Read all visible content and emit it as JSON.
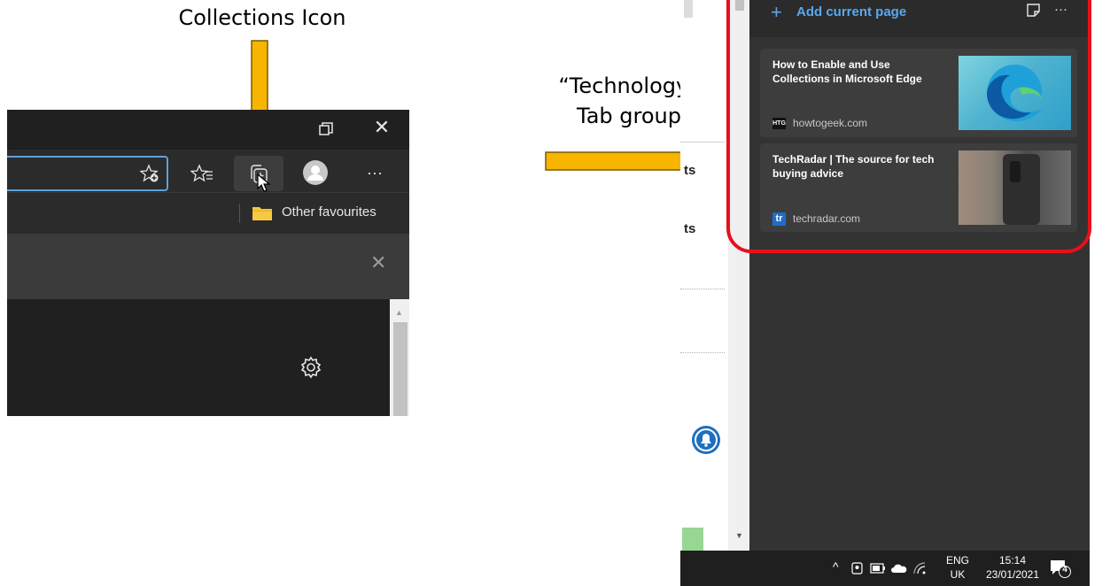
{
  "annotations": {
    "collections_icon_label": "Collections Icon",
    "tab_group_label_line1": "“Technology”",
    "tab_group_label_line2": "Tab group",
    "arrow_color": "#f7b500",
    "highlight_color": "#e8101c"
  },
  "browser": {
    "titlebar": {
      "restore_icon": "restore-icon",
      "close_glyph": "✕"
    },
    "toolbar": {
      "icons": [
        "add-favorite-icon",
        "favorites-icon",
        "collections-icon",
        "profile-icon",
        "more-icon"
      ],
      "more_glyph": "···"
    },
    "favorites_bar": {
      "folder_label": "Other favourites"
    },
    "panel": {
      "close_glyph": "✕"
    },
    "content": {
      "settings_icon": "gear-icon"
    }
  },
  "collections_pane": {
    "add_current_page": "Add current page",
    "plus_glyph": "+",
    "more_glyph": "···",
    "items": [
      {
        "title": "How to Enable and Use Collections in Microsoft Edge",
        "source": "howtogeek.com",
        "favicon_text": "HTG",
        "thumb": "edge-logo-thumbnail"
      },
      {
        "title": "TechRadar | The source for tech buying advice",
        "source": "techradar.com",
        "favicon_text": "tr",
        "thumb": "phone-thumbnail"
      }
    ]
  },
  "page_behind": {
    "fragment1": "ts",
    "fragment2": "ts"
  },
  "taskbar": {
    "language_line1": "ENG",
    "language_line2": "UK",
    "time": "15:14",
    "date": "23/01/2021",
    "notification_count": "4"
  }
}
